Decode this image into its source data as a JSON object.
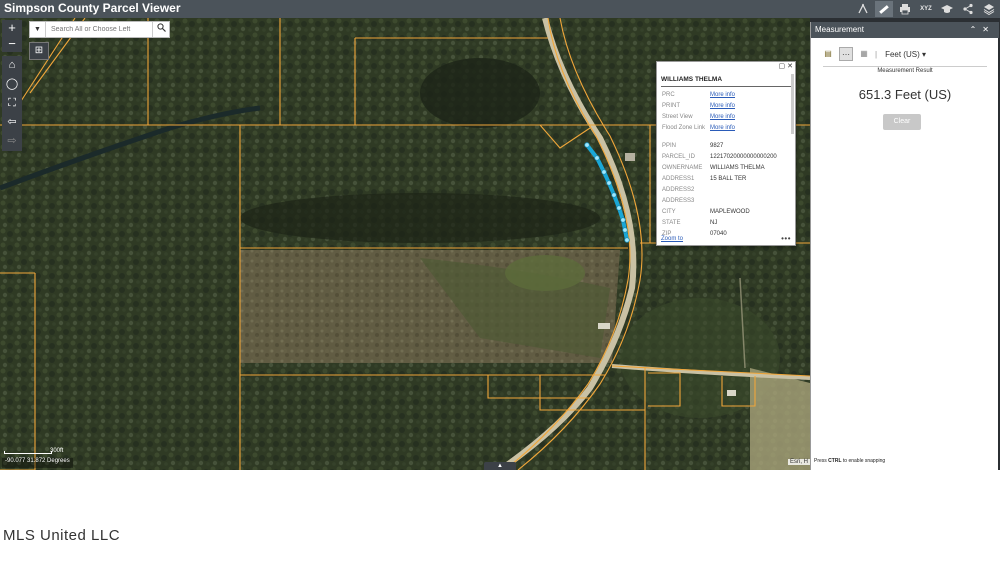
{
  "app": {
    "title": "Simpson County Parcel Viewer",
    "toolbar": [
      "measure-icon",
      "ruler-icon",
      "print-icon",
      "xyz-icon",
      "graduation-icon",
      "share-icon",
      "layers-icon"
    ]
  },
  "map": {
    "zoom_in": "+",
    "zoom_out": "−",
    "search_placeholder": "Search All or Choose Left",
    "scale_label": "300ft",
    "coords": "-90.077 31.872 Degrees",
    "attribution": "Esri, H",
    "measure_points": 10
  },
  "popup": {
    "title": "WILLIAMS THELMA",
    "fields": [
      {
        "key": "PRC",
        "value": "More info",
        "link": true
      },
      {
        "key": "PRINT",
        "value": "More info",
        "link": true
      },
      {
        "key": "Street View",
        "value": "More info",
        "link": true
      },
      {
        "key": "Flood Zone Link",
        "value": "More info",
        "link": true
      },
      {
        "key": "PPIN",
        "value": "9827",
        "link": false
      },
      {
        "key": "PARCEL_ID",
        "value": "12217020000000000200",
        "link": false
      },
      {
        "key": "OWNERNAME",
        "value": "WILLIAMS THELMA",
        "link": false
      },
      {
        "key": "ADDRESS1",
        "value": "15 BALL TER",
        "link": false
      },
      {
        "key": "ADDRESS2",
        "value": "",
        "link": false
      },
      {
        "key": "ADDRESS3",
        "value": "",
        "link": false
      },
      {
        "key": "CITY",
        "value": "MAPLEWOOD",
        "link": false
      },
      {
        "key": "STATE",
        "value": "NJ",
        "link": false
      },
      {
        "key": "ZIP",
        "value": "07040",
        "link": false
      }
    ],
    "zoom_to": "Zoom to",
    "more": "•••"
  },
  "panel": {
    "title": "Measurement",
    "unit": "Feet (US)",
    "result_label": "Measurement Result",
    "result_value": "651.3 Feet (US)",
    "clear_label": "Clear",
    "snap_hint_prefix": "Press ",
    "snap_hint_key": "CTRL",
    "snap_hint_suffix": " to enable snapping"
  },
  "watermark": "MLS United LLC"
}
